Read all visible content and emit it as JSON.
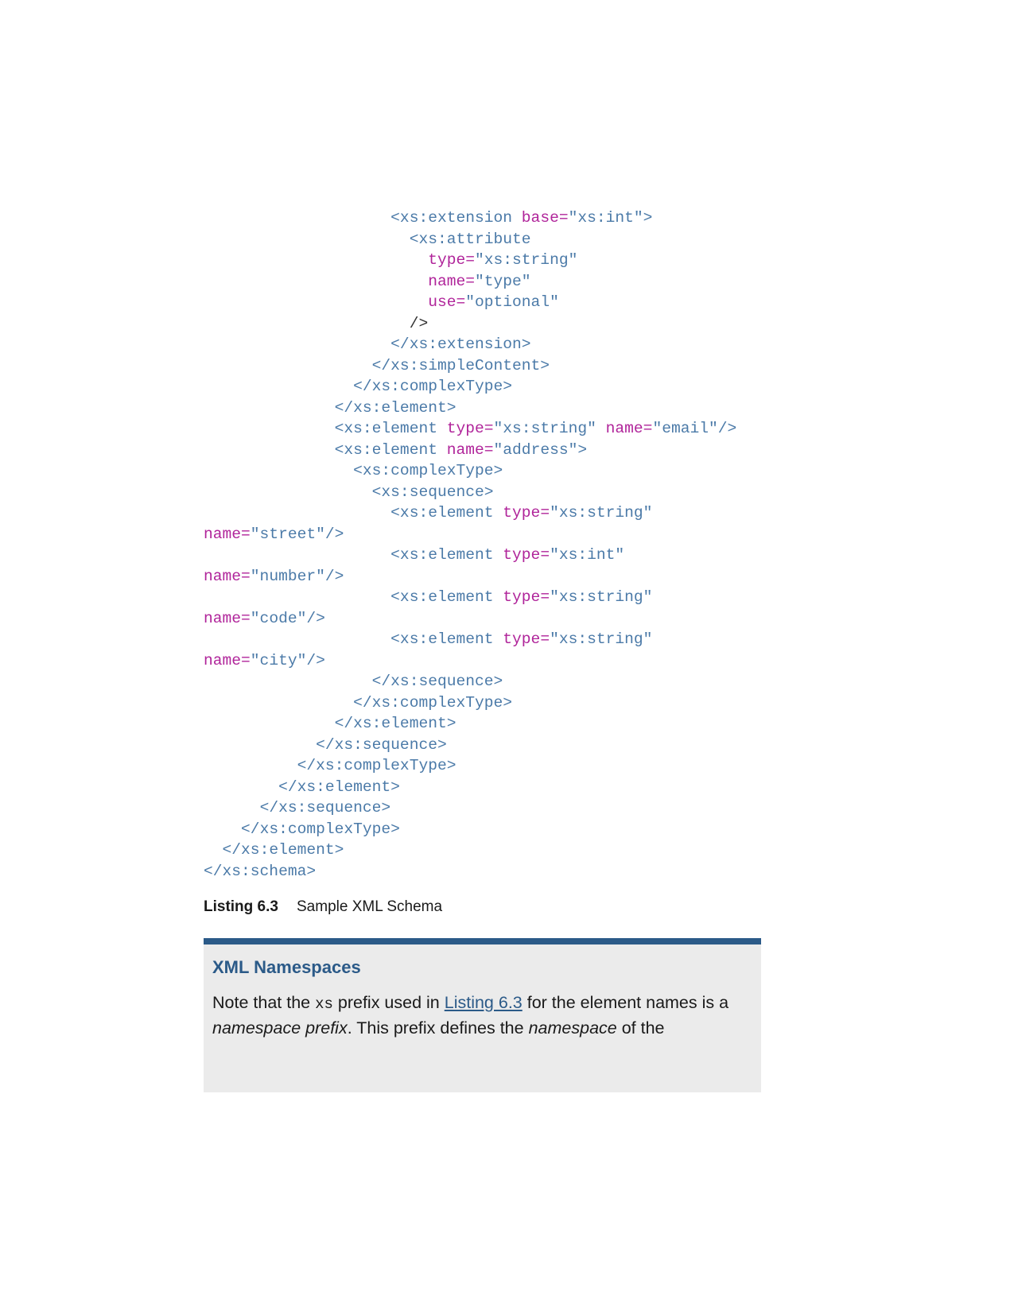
{
  "code_lines": [
    {
      "indent": 20,
      "tokens": [
        {
          "k": "tag",
          "t": "<xs:extension "
        },
        {
          "k": "attr",
          "t": "base="
        },
        {
          "k": "val",
          "t": "\"xs:int\">"
        }
      ]
    },
    {
      "indent": 22,
      "tokens": [
        {
          "k": "tag",
          "t": "<xs:attribute"
        }
      ]
    },
    {
      "indent": 24,
      "tokens": [
        {
          "k": "attr",
          "t": "type="
        },
        {
          "k": "val",
          "t": "\"xs:string\""
        }
      ]
    },
    {
      "indent": 24,
      "tokens": [
        {
          "k": "attr",
          "t": "name="
        },
        {
          "k": "val",
          "t": "\"type\""
        }
      ]
    },
    {
      "indent": 24,
      "tokens": [
        {
          "k": "attr",
          "t": "use="
        },
        {
          "k": "val",
          "t": "\"optional\""
        }
      ]
    },
    {
      "indent": 22,
      "tokens": [
        {
          "k": "plain",
          "t": "/>"
        }
      ]
    },
    {
      "indent": 20,
      "tokens": [
        {
          "k": "tag",
          "t": "</xs:extension>"
        }
      ]
    },
    {
      "indent": 18,
      "tokens": [
        {
          "k": "tag",
          "t": "</xs:simpleContent>"
        }
      ]
    },
    {
      "indent": 16,
      "tokens": [
        {
          "k": "tag",
          "t": "</xs:complexType>"
        }
      ]
    },
    {
      "indent": 14,
      "tokens": [
        {
          "k": "tag",
          "t": "</xs:element>"
        }
      ]
    },
    {
      "indent": 14,
      "tokens": [
        {
          "k": "tag",
          "t": "<xs:element "
        },
        {
          "k": "attr",
          "t": "type="
        },
        {
          "k": "val",
          "t": "\"xs:string\" "
        },
        {
          "k": "attr",
          "t": "name="
        },
        {
          "k": "val",
          "t": "\"email\"/>"
        }
      ]
    },
    {
      "indent": 14,
      "tokens": [
        {
          "k": "tag",
          "t": "<xs:element "
        },
        {
          "k": "attr",
          "t": "name="
        },
        {
          "k": "val",
          "t": "\"address\">"
        }
      ]
    },
    {
      "indent": 16,
      "tokens": [
        {
          "k": "tag",
          "t": "<xs:complexType>"
        }
      ]
    },
    {
      "indent": 18,
      "tokens": [
        {
          "k": "tag",
          "t": "<xs:sequence>"
        }
      ]
    },
    {
      "indent": 20,
      "tokens": [
        {
          "k": "tag",
          "t": "<xs:element "
        },
        {
          "k": "attr",
          "t": "type="
        },
        {
          "k": "val",
          "t": "\"xs:string\""
        }
      ]
    },
    {
      "indent": 0,
      "tokens": [
        {
          "k": "attr",
          "t": "name="
        },
        {
          "k": "val",
          "t": "\"street\"/>"
        }
      ]
    },
    {
      "indent": 20,
      "tokens": [
        {
          "k": "tag",
          "t": "<xs:element "
        },
        {
          "k": "attr",
          "t": "type="
        },
        {
          "k": "val",
          "t": "\"xs:int\""
        }
      ]
    },
    {
      "indent": 0,
      "tokens": [
        {
          "k": "attr",
          "t": "name="
        },
        {
          "k": "val",
          "t": "\"number\"/>"
        }
      ]
    },
    {
      "indent": 20,
      "tokens": [
        {
          "k": "tag",
          "t": "<xs:element "
        },
        {
          "k": "attr",
          "t": "type="
        },
        {
          "k": "val",
          "t": "\"xs:string\""
        }
      ]
    },
    {
      "indent": 0,
      "tokens": [
        {
          "k": "attr",
          "t": "name="
        },
        {
          "k": "val",
          "t": "\"code\"/>"
        }
      ]
    },
    {
      "indent": 20,
      "tokens": [
        {
          "k": "tag",
          "t": "<xs:element "
        },
        {
          "k": "attr",
          "t": "type="
        },
        {
          "k": "val",
          "t": "\"xs:string\""
        }
      ]
    },
    {
      "indent": 0,
      "tokens": [
        {
          "k": "attr",
          "t": "name="
        },
        {
          "k": "val",
          "t": "\"city\"/>"
        }
      ]
    },
    {
      "indent": 18,
      "tokens": [
        {
          "k": "tag",
          "t": "</xs:sequence>"
        }
      ]
    },
    {
      "indent": 16,
      "tokens": [
        {
          "k": "tag",
          "t": "</xs:complexType>"
        }
      ]
    },
    {
      "indent": 14,
      "tokens": [
        {
          "k": "tag",
          "t": "</xs:element>"
        }
      ]
    },
    {
      "indent": 12,
      "tokens": [
        {
          "k": "tag",
          "t": "</xs:sequence>"
        }
      ]
    },
    {
      "indent": 10,
      "tokens": [
        {
          "k": "tag",
          "t": "</xs:complexType>"
        }
      ]
    },
    {
      "indent": 8,
      "tokens": [
        {
          "k": "tag",
          "t": "</xs:element>"
        }
      ]
    },
    {
      "indent": 6,
      "tokens": [
        {
          "k": "tag",
          "t": "</xs:sequence>"
        }
      ]
    },
    {
      "indent": 4,
      "tokens": [
        {
          "k": "tag",
          "t": "</xs:complexType>"
        }
      ]
    },
    {
      "indent": 2,
      "tokens": [
        {
          "k": "tag",
          "t": "</xs:element>"
        }
      ]
    },
    {
      "indent": 0,
      "tokens": [
        {
          "k": "tag",
          "t": "</xs:schema>"
        }
      ]
    }
  ],
  "caption": {
    "label": "Listing 6.3",
    "text": "Sample XML Schema"
  },
  "sidebar": {
    "title": "XML Namespaces",
    "body_1": "Note that the ",
    "code_prefix": "xs",
    "body_2": " prefix used in ",
    "link_text": "Listing 6.3",
    "body_3": " for the element names is a ",
    "em_1": "namespace prefix",
    "body_4": ". This prefix defines the ",
    "em_2": "namespace",
    "body_5": " of the"
  },
  "colors": {
    "tag": "#4b7aa8",
    "attr": "#b0249a",
    "accent": "#2b5a88",
    "sidebar_bg": "#ebebeb"
  }
}
